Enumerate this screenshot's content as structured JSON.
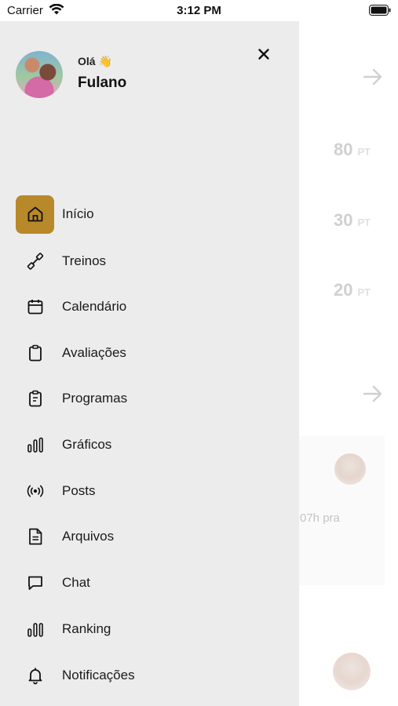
{
  "status_bar": {
    "carrier": "Carrier",
    "time": "3:12 PM"
  },
  "profile": {
    "greeting": "Olá 👋",
    "name": "Fulano"
  },
  "menu": {
    "items": [
      {
        "label": "Início",
        "icon": "home-icon",
        "active": true
      },
      {
        "label": "Treinos",
        "icon": "dumbbell-icon",
        "active": false
      },
      {
        "label": "Calendário",
        "icon": "calendar-icon",
        "active": false
      },
      {
        "label": "Avaliações",
        "icon": "clipboard-icon",
        "active": false
      },
      {
        "label": "Programas",
        "icon": "clipboard-list-icon",
        "active": false
      },
      {
        "label": "Gráficos",
        "icon": "bar-chart-icon",
        "active": false
      },
      {
        "label": "Posts",
        "icon": "broadcast-icon",
        "active": false
      },
      {
        "label": "Arquivos",
        "icon": "file-icon",
        "active": false
      },
      {
        "label": "Chat",
        "icon": "chat-icon",
        "active": false
      },
      {
        "label": "Ranking",
        "icon": "ranking-icon",
        "active": false
      },
      {
        "label": "Notificações",
        "icon": "bell-icon",
        "active": false
      }
    ]
  },
  "background": {
    "points": [
      {
        "value": "80",
        "unit": "PT"
      },
      {
        "value": "30",
        "unit": "PT"
      },
      {
        "value": "20",
        "unit": "PT"
      }
    ],
    "snippet": "07h pra"
  },
  "colors": {
    "accent": "#b8892a",
    "drawer_bg": "#ececec"
  }
}
